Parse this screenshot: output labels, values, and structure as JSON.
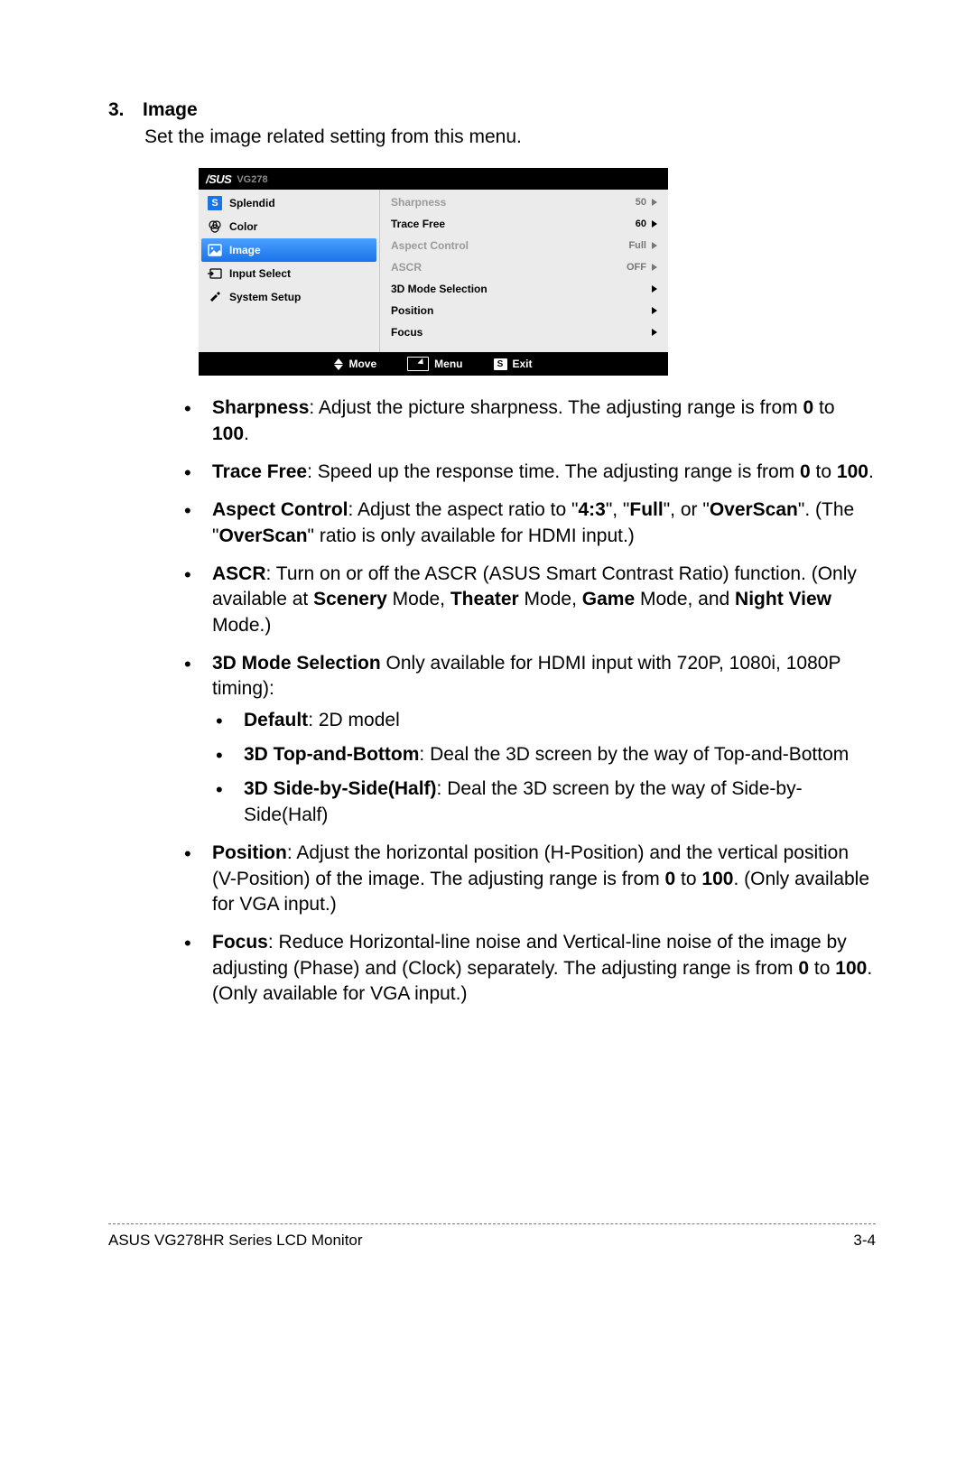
{
  "section": {
    "number": "3.",
    "title": "Image",
    "intro": "Set the image related setting from this menu."
  },
  "osd": {
    "brand": "/SUS",
    "model": "VG278",
    "left_items": [
      {
        "label": "Splendid",
        "icon": "s-badge"
      },
      {
        "label": "Color",
        "icon": "color"
      },
      {
        "label": "Image",
        "icon": "image",
        "active": true
      },
      {
        "label": "Input Select",
        "icon": "input"
      },
      {
        "label": "System Setup",
        "icon": "setup"
      }
    ],
    "right_items": [
      {
        "label": "Sharpness",
        "value": "50",
        "disabled": true
      },
      {
        "label": "Trace Free",
        "value": "60",
        "disabled": false
      },
      {
        "label": "Aspect Control",
        "value": "Full",
        "disabled": true
      },
      {
        "label": "ASCR",
        "value": "OFF",
        "disabled": true
      },
      {
        "label": "3D Mode Selection",
        "value": "",
        "disabled": false
      },
      {
        "label": "Position",
        "value": "",
        "disabled": false
      },
      {
        "label": "Focus",
        "value": "",
        "disabled": false
      }
    ],
    "footer": {
      "move": "Move",
      "menu": "Menu",
      "exit": "Exit",
      "exit_key": "S"
    }
  },
  "bullets": {
    "sharpness_label": "Sharpness",
    "sharpness_text_a": ": Adjust the picture sharpness. The adjusting range is from ",
    "sharpness_zero": "0",
    "sharpness_text_b": " to ",
    "sharpness_hundred": "100",
    "sharpness_text_c": ".",
    "tracefree_label": "Trace Free",
    "tracefree_text_a": ": Speed up the response time. The adjusting range is from ",
    "tracefree_zero": "0",
    "tracefree_text_b": " to ",
    "tracefree_hundred": "100",
    "tracefree_text_c": ".",
    "aspect_label": "Aspect Control",
    "aspect_text_a": ": Adjust the aspect ratio to \"",
    "aspect_43": "4:3",
    "aspect_text_b": "\", \"",
    "aspect_full": "Full",
    "aspect_text_c": "\", or \"",
    "aspect_over": "OverScan",
    "aspect_text_d": "\". (The \"",
    "aspect_over2": "OverScan",
    "aspect_text_e": "\" ratio is only available for HDMI input.)",
    "ascr_label": "ASCR",
    "ascr_text_a": ": Turn on or off the ASCR (ASUS Smart Contrast Ratio) function. (Only available at ",
    "ascr_scenery": "Scenery",
    "ascr_text_b": " Mode, ",
    "ascr_theater": "Theater",
    "ascr_text_c": " Mode, ",
    "ascr_game": "Game",
    "ascr_text_d": " Mode, and ",
    "ascr_night": "Night View",
    "ascr_text_e": " Mode.)",
    "mode3d_label": "3D Mode Selection",
    "mode3d_text": " Only available for HDMI input with 720P, 1080i, 1080P timing):",
    "mode3d_default_label": "Default",
    "mode3d_default_text": ": 2D model",
    "mode3d_tb_label": "3D Top-and-Bottom",
    "mode3d_tb_text": ": Deal the 3D screen by the way of Top-and-Bottom",
    "mode3d_sbs_label": "3D Side-by-Side(Half)",
    "mode3d_sbs_text": ": Deal the 3D screen by the way of Side-by-Side(Half)",
    "position_label": "Position",
    "position_text_a": ": Adjust the horizontal position (H-Position) and the vertical position (V-Position) of the image. The adjusting range is from ",
    "position_zero": "0",
    "position_text_b": " to ",
    "position_hundred": "100",
    "position_text_c": ". (Only available for VGA input.)",
    "focus_label": "Focus",
    "focus_text_a": ": Reduce Horizontal-line noise and Vertical-line noise of the image by adjusting (Phase) and (Clock) separately. The adjusting range is from ",
    "focus_zero": "0",
    "focus_text_b": " to ",
    "focus_hundred": "100",
    "focus_text_c": ". (Only available for VGA input.)"
  },
  "footer": {
    "left": "ASUS VG278HR Series LCD Monitor",
    "right": "3-4"
  }
}
